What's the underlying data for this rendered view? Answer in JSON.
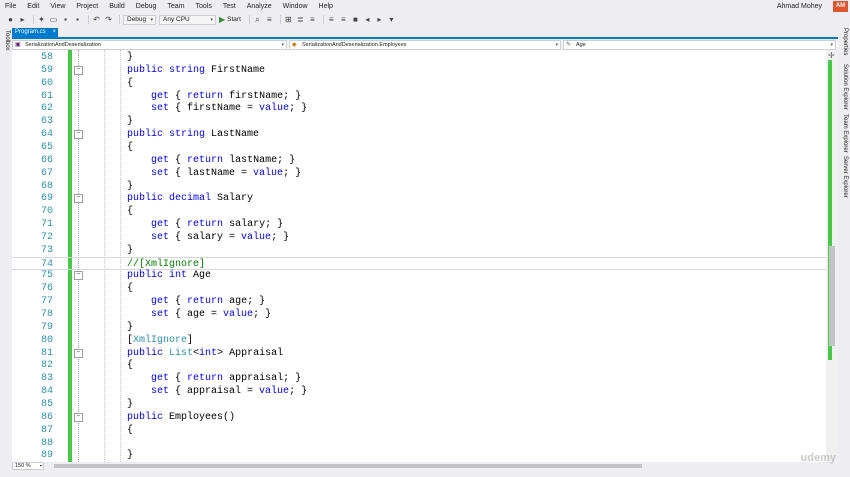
{
  "menu": {
    "items": [
      "File",
      "Edit",
      "View",
      "Project",
      "Build",
      "Debug",
      "Team",
      "Tools",
      "Test",
      "Analyze",
      "Window",
      "Help"
    ],
    "user_name": "Ahmad Mohey",
    "user_initials": "AM"
  },
  "toolbar": {
    "config": "Debug",
    "platform": "Any CPU",
    "start_label": "Start"
  },
  "side_tabs": {
    "left": "Toolbox",
    "right": [
      "Properties",
      "Solution Explorer",
      "Team Explorer",
      "Server Explorer"
    ]
  },
  "doc_tab": {
    "label": "Program.cs",
    "close": "×"
  },
  "navbar": {
    "project": "SerializationAndDeserialization",
    "class": "SerializationAndDeserialization.Employees",
    "member": "Age"
  },
  "zoom": "150 %",
  "watermark": "udemy",
  "code_lines": [
    {
      "n": "58",
      "t": [
        [
          "p",
          "}"
        ]
      ]
    },
    {
      "n": "59",
      "t": [
        [
          "k",
          "public "
        ],
        [
          "k",
          "string "
        ],
        [
          "p",
          "FirstName"
        ]
      ]
    },
    {
      "n": "60",
      "t": [
        [
          "p",
          "{"
        ]
      ]
    },
    {
      "n": "61",
      "t": [
        [
          "p",
          "    "
        ],
        [
          "k",
          "get"
        ],
        [
          "p",
          " { "
        ],
        [
          "k",
          "return"
        ],
        [
          "p",
          " firstName; }"
        ]
      ]
    },
    {
      "n": "62",
      "t": [
        [
          "p",
          "    "
        ],
        [
          "k",
          "set"
        ],
        [
          "p",
          " { firstName = "
        ],
        [
          "k",
          "value"
        ],
        [
          "p",
          "; }"
        ]
      ]
    },
    {
      "n": "63",
      "t": [
        [
          "p",
          "}"
        ]
      ]
    },
    {
      "n": "64",
      "t": [
        [
          "k",
          "public "
        ],
        [
          "k",
          "string "
        ],
        [
          "p",
          "LastName"
        ]
      ]
    },
    {
      "n": "65",
      "t": [
        [
          "p",
          "{"
        ]
      ]
    },
    {
      "n": "66",
      "t": [
        [
          "p",
          "    "
        ],
        [
          "k",
          "get"
        ],
        [
          "p",
          " { "
        ],
        [
          "k",
          "return"
        ],
        [
          "p",
          " lastName; }"
        ]
      ]
    },
    {
      "n": "67",
      "t": [
        [
          "p",
          "    "
        ],
        [
          "k",
          "set"
        ],
        [
          "p",
          " { lastName = "
        ],
        [
          "k",
          "value"
        ],
        [
          "p",
          "; }"
        ]
      ]
    },
    {
      "n": "68",
      "t": [
        [
          "p",
          "}"
        ]
      ]
    },
    {
      "n": "69",
      "t": [
        [
          "k",
          "public "
        ],
        [
          "k",
          "decimal "
        ],
        [
          "p",
          "Salary"
        ]
      ]
    },
    {
      "n": "70",
      "t": [
        [
          "p",
          "{"
        ]
      ]
    },
    {
      "n": "71",
      "t": [
        [
          "p",
          "    "
        ],
        [
          "k",
          "get"
        ],
        [
          "p",
          " { "
        ],
        [
          "k",
          "return"
        ],
        [
          "p",
          " salary; }"
        ]
      ]
    },
    {
      "n": "72",
      "t": [
        [
          "p",
          "    "
        ],
        [
          "k",
          "set"
        ],
        [
          "p",
          " { salary = "
        ],
        [
          "k",
          "value"
        ],
        [
          "p",
          "; }"
        ]
      ]
    },
    {
      "n": "73",
      "t": [
        [
          "p",
          "}"
        ]
      ]
    },
    {
      "n": "74",
      "t": [
        [
          "c",
          "//[XmlIgnore]"
        ]
      ]
    },
    {
      "n": "75",
      "t": [
        [
          "k",
          "public "
        ],
        [
          "k",
          "int "
        ],
        [
          "p",
          "Age"
        ]
      ]
    },
    {
      "n": "76",
      "t": [
        [
          "p",
          "{"
        ]
      ]
    },
    {
      "n": "77",
      "t": [
        [
          "p",
          "    "
        ],
        [
          "k",
          "get"
        ],
        [
          "p",
          " { "
        ],
        [
          "k",
          "return"
        ],
        [
          "p",
          " age; }"
        ]
      ]
    },
    {
      "n": "78",
      "t": [
        [
          "p",
          "    "
        ],
        [
          "k",
          "set"
        ],
        [
          "p",
          " { age = "
        ],
        [
          "k",
          "value"
        ],
        [
          "p",
          "; }"
        ]
      ]
    },
    {
      "n": "79",
      "t": [
        [
          "p",
          "}"
        ]
      ]
    },
    {
      "n": "80",
      "t": [
        [
          "p",
          "["
        ],
        [
          "t",
          "XmlIgnore"
        ],
        [
          "p",
          "]"
        ]
      ]
    },
    {
      "n": "81",
      "t": [
        [
          "k",
          "public "
        ],
        [
          "t",
          "List"
        ],
        [
          "p",
          "<"
        ],
        [
          "k",
          "int"
        ],
        [
          "p",
          "> Appraisal"
        ]
      ]
    },
    {
      "n": "82",
      "t": [
        [
          "p",
          "{"
        ]
      ]
    },
    {
      "n": "83",
      "t": [
        [
          "p",
          "    "
        ],
        [
          "k",
          "get"
        ],
        [
          "p",
          " { "
        ],
        [
          "k",
          "return"
        ],
        [
          "p",
          " appraisal; }"
        ]
      ]
    },
    {
      "n": "84",
      "t": [
        [
          "p",
          "    "
        ],
        [
          "k",
          "set"
        ],
        [
          "p",
          " { appraisal = "
        ],
        [
          "k",
          "value"
        ],
        [
          "p",
          "; }"
        ]
      ]
    },
    {
      "n": "85",
      "t": [
        [
          "p",
          "}"
        ]
      ]
    },
    {
      "n": "86",
      "t": [
        [
          "k",
          "public "
        ],
        [
          "p",
          "Employees()"
        ]
      ]
    },
    {
      "n": "87",
      "t": [
        [
          "p",
          "{"
        ]
      ]
    },
    {
      "n": "88",
      "t": [
        [
          "p",
          ""
        ]
      ]
    },
    {
      "n": "89",
      "t": [
        [
          "p",
          "}"
        ]
      ]
    }
  ]
}
